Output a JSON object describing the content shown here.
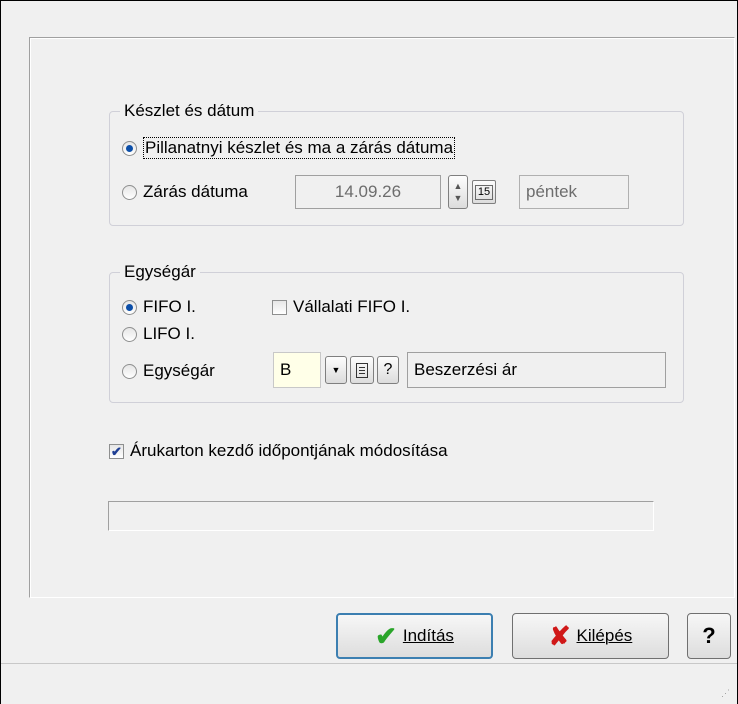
{
  "stock_group": {
    "title": "Készlet és dátum",
    "option_current": "Pillanatnyi készlet és ma a zárás dátuma",
    "option_closing": "Zárás dátuma",
    "closing_date": "14.09.26",
    "calendar_label": "15",
    "weekday": "péntek",
    "selected": "current"
  },
  "unit_price_group": {
    "title": "Egységár",
    "option_fifo": "FIFO I.",
    "option_lifo": "LIFO I.",
    "option_unit_price": "Egységár",
    "company_fifo_label": "Vállalati FIFO I.",
    "company_fifo_checked": false,
    "code_value": "B",
    "help_label": "?",
    "price_type": "Beszerzési ár",
    "selected": "fifo"
  },
  "modify_card_start": {
    "label": "Árukarton kezdő időpontjának módosítása",
    "checked": true
  },
  "progress": {
    "value": 0
  },
  "buttons": {
    "start_label": "Indítás",
    "exit_label": "Kilépés",
    "help_label": "?"
  },
  "icons": {
    "start": "check-icon",
    "exit": "x-icon",
    "calendar": "calendar-icon",
    "document": "document-icon",
    "dropdown": "chevron-down-icon",
    "spin": "spin-arrows-icon"
  }
}
